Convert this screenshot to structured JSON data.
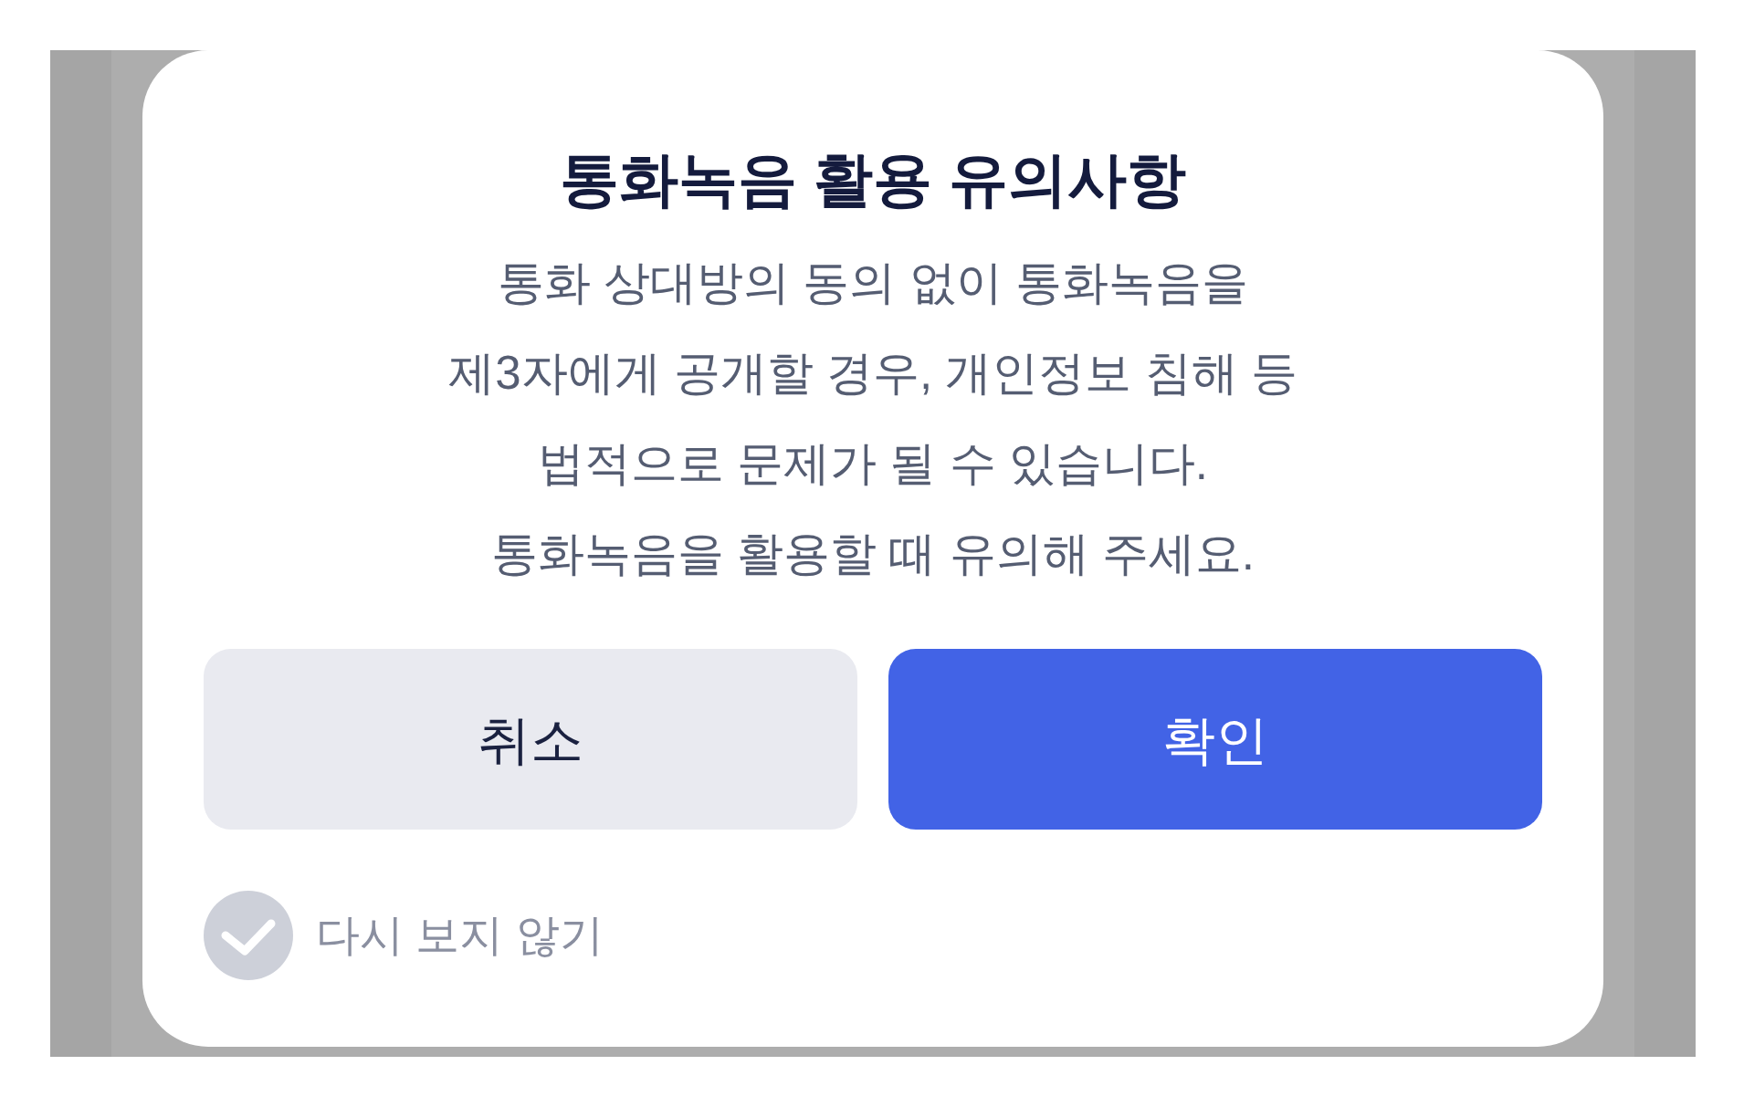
{
  "dialog": {
    "title": "통화녹음 활용 유의사항",
    "message": "통화 상대방의 동의 없이 통화녹음을\n제3자에게 공개할 경우, 개인정보 침해 등\n법적으로 문제가 될 수 있습니다.\n통화녹음을 활용할 때 유의해 주세요.",
    "buttons": [
      {
        "label": "취소",
        "kind": "secondary"
      },
      {
        "label": "확인",
        "kind": "primary"
      }
    ],
    "dont_show_again": {
      "label": "다시 보지 않기",
      "checked": false
    }
  }
}
